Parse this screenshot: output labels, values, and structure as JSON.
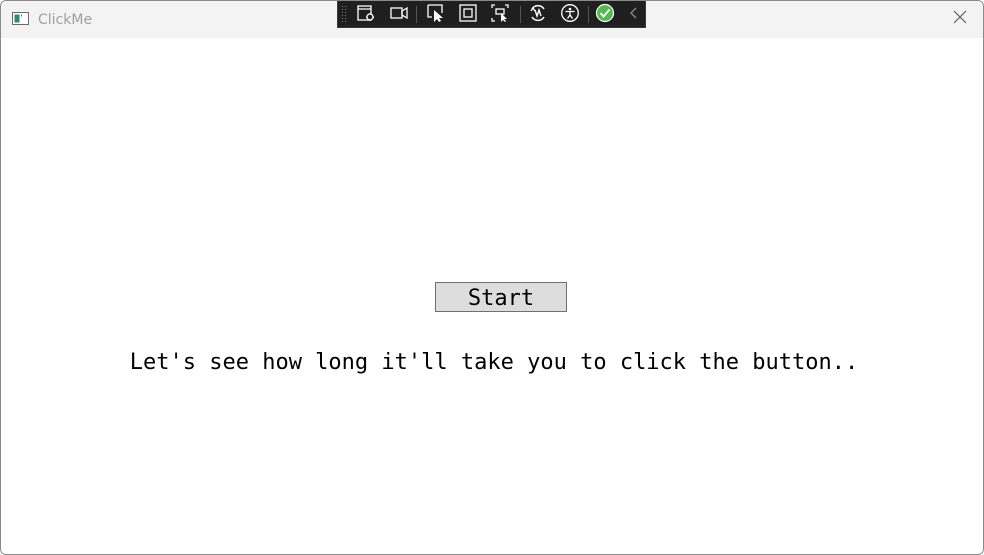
{
  "window": {
    "title": "ClickMe",
    "icons": {
      "app": "window-app-icon",
      "close": "close-icon"
    }
  },
  "debug_toolbar": {
    "tools": [
      "live-visual-tree-icon",
      "video-camera-icon",
      "select-element-icon",
      "display-layout-adorners-icon",
      "track-focus-icon",
      "hot-reload-icon",
      "accessibility-icon",
      "binding-check-icon",
      "collapse-chevron-icon"
    ],
    "accent": "#55b94d"
  },
  "main": {
    "start_button_label": "Start",
    "message": "Let's see how long it'll take you to click the button.."
  }
}
